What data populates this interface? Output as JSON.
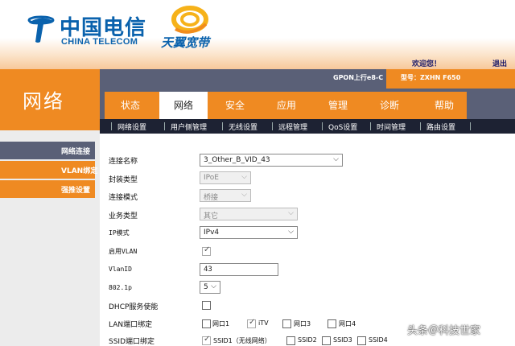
{
  "brand": {
    "logo_cn": "中国电信",
    "logo_en": "CHINA TELECOM",
    "sub_logo": "天翼宽带"
  },
  "header": {
    "welcome": "欢迎您！",
    "logout": "退出",
    "device": "GPON上行e8-C",
    "model": "型号：ZXHN F650"
  },
  "section_title": "网络",
  "nav": {
    "tabs": [
      "状态",
      "网络",
      "安全",
      "应用",
      "管理",
      "诊断",
      "帮助"
    ],
    "active": "网络"
  },
  "subnav": [
    "网络设置",
    "用户侧管理",
    "无线设置",
    "远程管理",
    "QoS设置",
    "时间管理",
    "路由设置"
  ],
  "sidebar": {
    "items": [
      "网络连接",
      "VLAN绑定",
      "强推设置"
    ]
  },
  "form": {
    "connection_name_label": "连接名称",
    "connection_name_value": "3_Other_B_VID_43",
    "encap_label": "封装类型",
    "encap_value": "IPoE",
    "conn_mode_label": "连接模式",
    "conn_mode_value": "桥接",
    "service_type_label": "业务类型",
    "service_type_value": "其它",
    "ip_mode_label": "IP模式",
    "ip_mode_value": "IPv4",
    "enable_vlan_label": "启用VLAN",
    "vlanid_label": "VlanID",
    "vlanid_value": "43",
    "dot1p_label": "802.1p",
    "dot1p_value": "5",
    "dhcp_label": "DHCP服务使能",
    "lan_bind_label": "LAN端口绑定",
    "lan_ports": [
      "网口1",
      "iTV",
      "网口3",
      "网口4"
    ],
    "ssid_bind_label": "SSID端口绑定",
    "ssids": [
      "SSID1（无线网络）",
      "SSID2",
      "SSID3",
      "SSID4"
    ]
  },
  "watermark": "头条＠科技世家",
  "colors": {
    "orange": "#ef8a22",
    "slate": "#5a6077",
    "brand_blue": "#0a62ad"
  }
}
